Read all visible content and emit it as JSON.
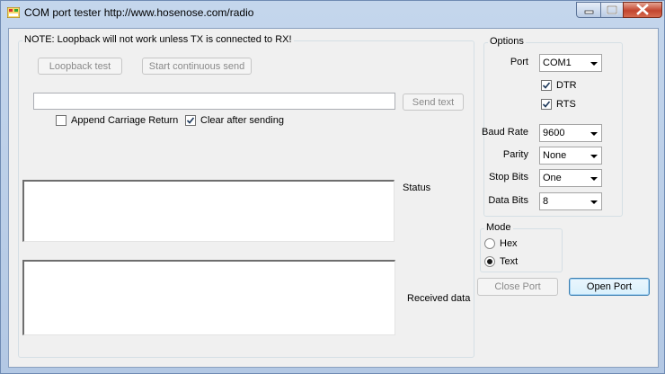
{
  "window": {
    "title": "COM port tester http://www.hosenose.com/radio"
  },
  "main": {
    "note": "NOTE: Loopback will not work unless TX is connected to RX!",
    "loopback_button": "Loopback test",
    "continuous_button": "Start continuous send",
    "send_input_value": "",
    "send_button": "Send text",
    "append_cr_label": "Append Carriage Return",
    "append_cr_checked": false,
    "clear_after_label": "Clear after sending",
    "clear_after_checked": true,
    "status_label": "Status",
    "received_label": "Received data"
  },
  "options": {
    "title": "Options",
    "port_label": "Port",
    "port_value": "COM1",
    "dtr_label": "DTR",
    "dtr_checked": true,
    "rts_label": "RTS",
    "rts_checked": true,
    "baud_label": "Baud Rate",
    "baud_value": "9600",
    "parity_label": "Parity",
    "parity_value": "None",
    "stop_label": "Stop Bits",
    "stop_value": "One",
    "data_label": "Data Bits",
    "data_value": "8"
  },
  "mode": {
    "title": "Mode",
    "hex_label": "Hex",
    "text_label": "Text",
    "selected": "Text"
  },
  "port_buttons": {
    "close_label": "Close Port",
    "open_label": "Open Port"
  }
}
